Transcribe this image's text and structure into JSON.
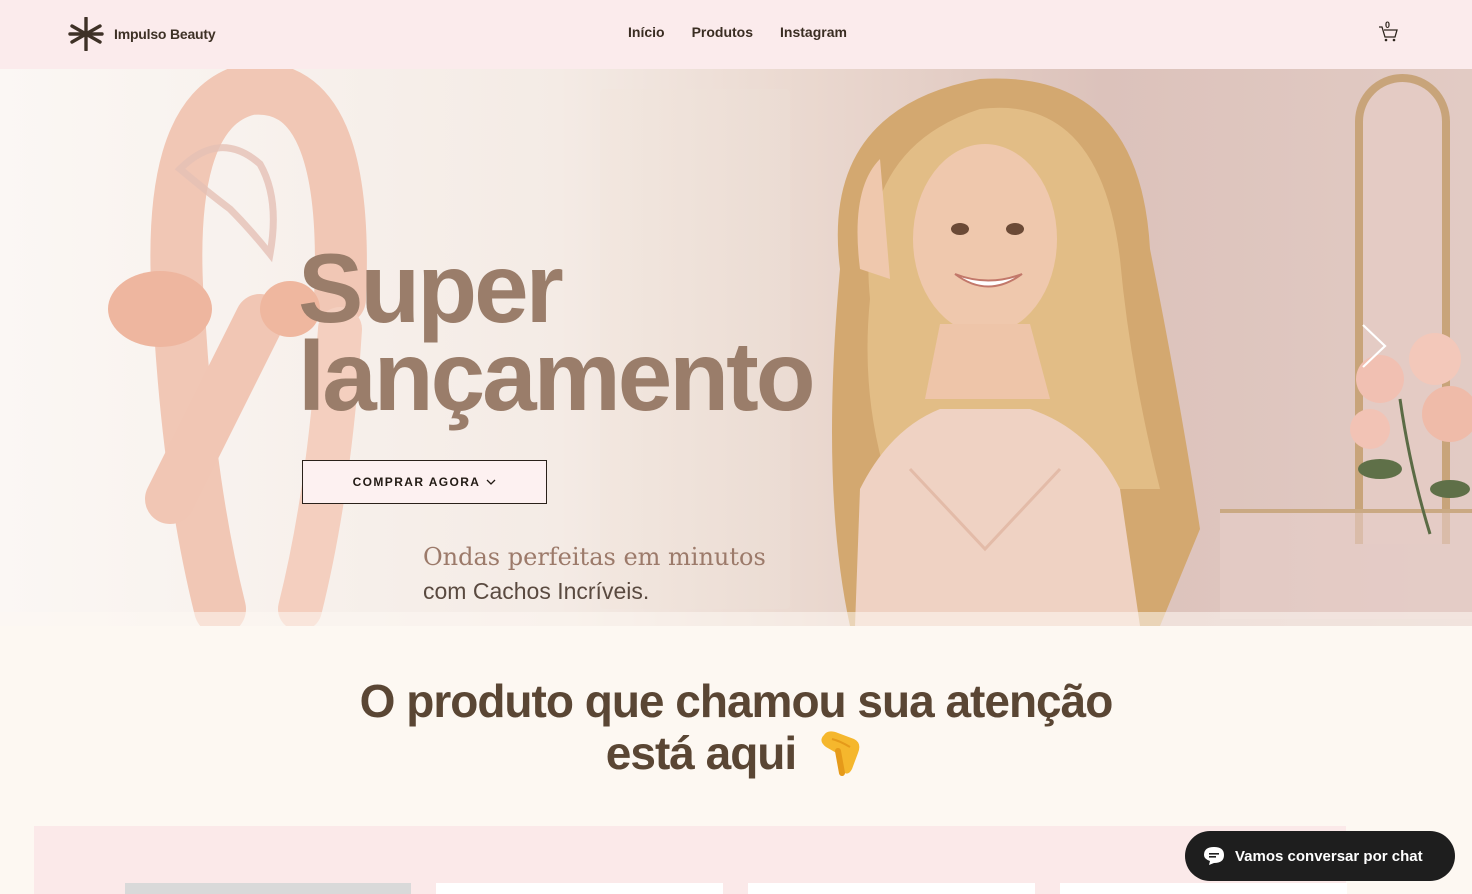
{
  "header": {
    "brand": "Impulso Beauty",
    "nav": [
      "Início",
      "Produtos",
      "Instagram"
    ],
    "cart_count": "0"
  },
  "hero": {
    "title_line1": "Super",
    "title_line2": "lançamento",
    "cta_label": "COMPRAR AGORA",
    "subtitle_line1": "Ondas perfeitas em minutos",
    "subtitle_line2": "com Cachos Incríveis."
  },
  "section": {
    "title_line1": "O produto que chamou sua atenção",
    "title_line2": "está aqui"
  },
  "chat": {
    "label": "Vamos conversar por chat"
  },
  "icons": [
    "asterisk-logo-icon",
    "cart-icon",
    "chevron-down-icon",
    "chevron-right-icon",
    "pointing-down-hand-icon",
    "chat-bubble-icon"
  ],
  "colors": {
    "header_bg": "#fbebec",
    "title_color": "#9a7d6a",
    "section_title": "#5a4634",
    "chat_bg": "#1e1e1e"
  }
}
